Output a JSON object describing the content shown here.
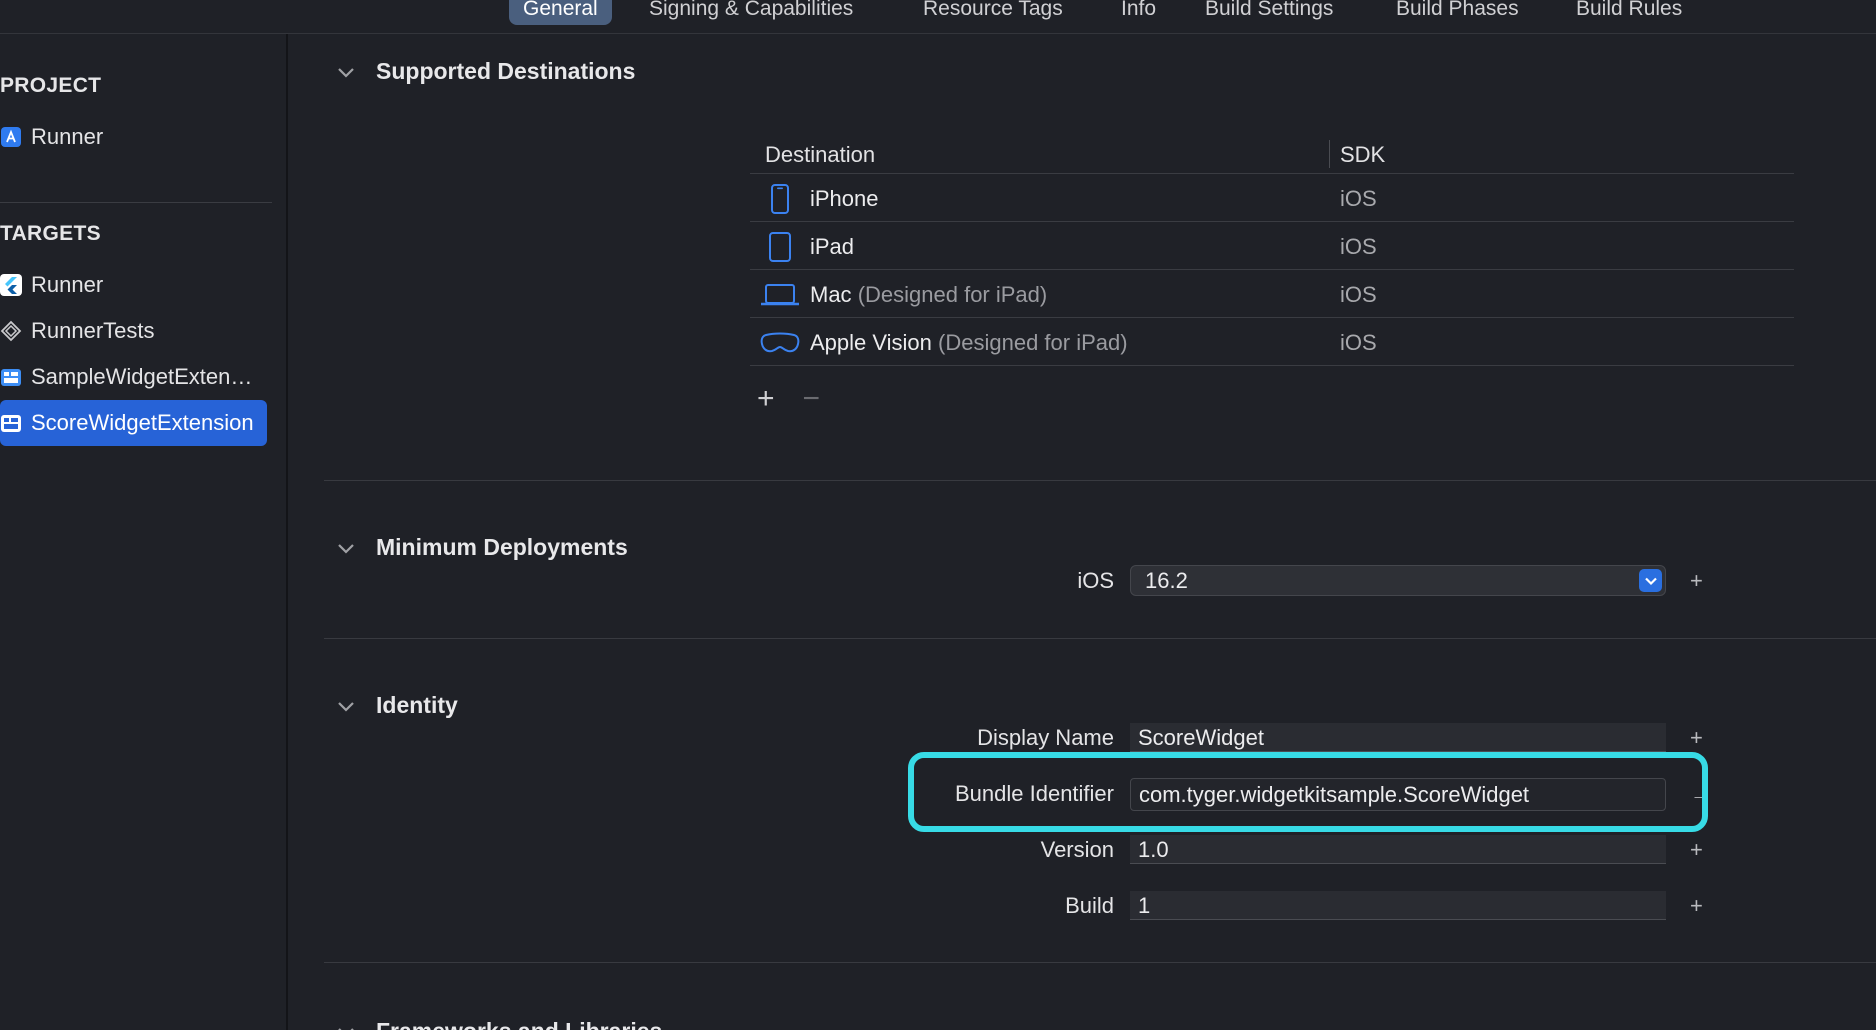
{
  "tabs": [
    {
      "label": "General",
      "active": true
    },
    {
      "label": "Signing & Capabilities"
    },
    {
      "label": "Resource Tags"
    },
    {
      "label": "Info"
    },
    {
      "label": "Build Settings"
    },
    {
      "label": "Build Phases"
    },
    {
      "label": "Build Rules"
    }
  ],
  "sidebar": {
    "project_header": "PROJECT",
    "project_items": [
      {
        "label": "Runner",
        "icon": "app-store-icon"
      }
    ],
    "targets_header": "TARGETS",
    "target_items": [
      {
        "label": "Runner",
        "icon": "flutter-icon"
      },
      {
        "label": "RunnerTests",
        "icon": "test-bundle-icon"
      },
      {
        "label": "SampleWidgetExtension",
        "icon": "widget-extension-icon"
      },
      {
        "label": "ScoreWidgetExtension",
        "icon": "widget-extension-icon",
        "selected": true
      }
    ]
  },
  "supported_destinations": {
    "title": "Supported Destinations",
    "columns": [
      "Destination",
      "SDK"
    ],
    "rows": [
      {
        "icon": "iphone-icon",
        "name": "iPhone",
        "note": "",
        "sdk": "iOS"
      },
      {
        "icon": "ipad-icon",
        "name": "iPad",
        "note": "",
        "sdk": "iOS"
      },
      {
        "icon": "mac-icon",
        "name": "Mac",
        "note": "(Designed for iPad)",
        "sdk": "iOS"
      },
      {
        "icon": "vision-pro-icon",
        "name": "Apple Vision",
        "note": "(Designed for iPad)",
        "sdk": "iOS"
      }
    ],
    "add_label": "+",
    "remove_label": "−"
  },
  "minimum_deployments": {
    "title": "Minimum Deployments",
    "ios_label": "iOS",
    "ios_value": "16.2",
    "add_label": "+"
  },
  "identity": {
    "title": "Identity",
    "display_name_label": "Display Name",
    "display_name_value": "ScoreWidget",
    "bundle_id_label": "Bundle Identifier",
    "bundle_id_value": "com.tyger.widgetkitsample.ScoreWidget",
    "version_label": "Version",
    "version_value": "1.0",
    "build_label": "Build",
    "build_value": "1",
    "add_label": "+",
    "arrow_label": "→"
  },
  "frameworks": {
    "title": "Frameworks and Libraries"
  },
  "colors": {
    "accent": "#2763d7",
    "highlight": "#37dbe6"
  }
}
